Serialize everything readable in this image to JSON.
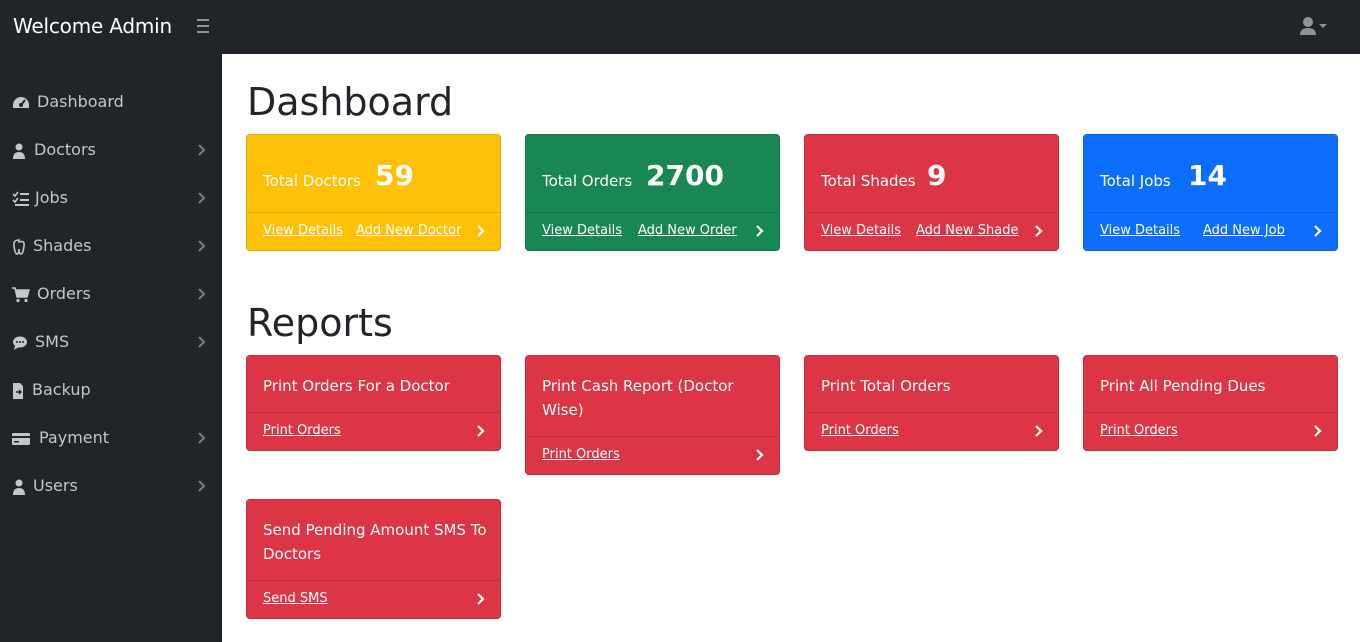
{
  "app": {
    "brand": "Welcome Admin"
  },
  "colors": {
    "warning": "#ffc107",
    "success": "#198754",
    "danger": "#dc3545",
    "primary": "#0d6efd",
    "sidebar": "#212529"
  },
  "sidebar": {
    "items": [
      {
        "label": "Dashboard",
        "icon": "tachometer-icon",
        "has_submenu": false
      },
      {
        "label": "Doctors",
        "icon": "user-doctor-icon",
        "has_submenu": true
      },
      {
        "label": "Jobs",
        "icon": "list-check-icon",
        "has_submenu": true
      },
      {
        "label": "Shades",
        "icon": "tooth-icon",
        "has_submenu": true
      },
      {
        "label": "Orders",
        "icon": "shopping-cart-icon",
        "has_submenu": true
      },
      {
        "label": "SMS",
        "icon": "sms-icon",
        "has_submenu": true
      },
      {
        "label": "Backup",
        "icon": "file-export-icon",
        "has_submenu": false
      },
      {
        "label": "Payment",
        "icon": "credit-card-icon",
        "has_submenu": true
      },
      {
        "label": "Users",
        "icon": "user-icon",
        "has_submenu": true
      }
    ]
  },
  "dashboard": {
    "title": "Dashboard",
    "cards": [
      {
        "title": "Total Doctors",
        "value": "59",
        "view_label": "View Details",
        "add_label": "Add New Doctor"
      },
      {
        "title": "Total Orders",
        "value": "2700",
        "view_label": "View Details",
        "add_label": "Add New Order"
      },
      {
        "title": "Total Shades",
        "value": "9",
        "view_label": "View Details",
        "add_label": "Add New Shade"
      },
      {
        "title": "Total Jobs",
        "value": "14",
        "view_label": "View Details",
        "add_label": "Add New Job"
      }
    ]
  },
  "reports": {
    "title": "Reports",
    "cards": [
      {
        "title": "Print Orders For a Doctor",
        "link": "Print Orders"
      },
      {
        "title": "Print Cash Report (Doctor Wise)",
        "link": "Print Orders"
      },
      {
        "title": "Print Total Orders",
        "link": "Print Orders"
      },
      {
        "title": "Print All Pending Dues",
        "link": "Print Orders"
      },
      {
        "title": "Send Pending Amount SMS To Doctors",
        "link": "Send SMS"
      }
    ]
  }
}
